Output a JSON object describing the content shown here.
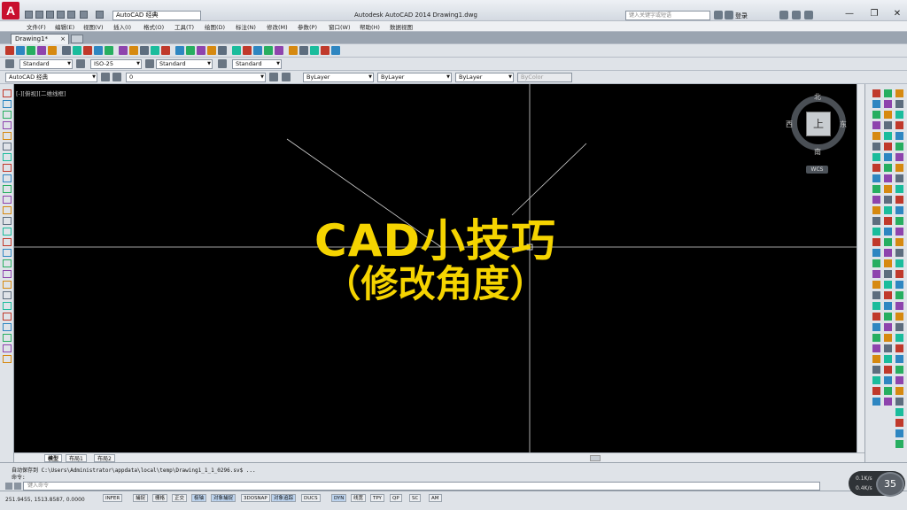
{
  "titlebar": {
    "app_logo": "A",
    "workspace": "AutoCAD 经典",
    "title": "Autodesk AutoCAD 2014    Drawing1.dwg",
    "search_placeholder": "键入关键字或短语",
    "login": "登录",
    "minimize": "—",
    "restore": "❐",
    "close": "✕"
  },
  "menu": [
    "文件(F)",
    "编辑(E)",
    "视图(V)",
    "插入(I)",
    "格式(O)",
    "工具(T)",
    "绘图(D)",
    "标注(N)",
    "修改(M)",
    "参数(P)",
    "窗口(W)",
    "帮助(H)",
    "数据视图"
  ],
  "tabs": {
    "doc_tab": "Drawing1*",
    "close": "×"
  },
  "styles": {
    "text_style": "Standard",
    "dim_style": "ISO-25",
    "table_style": "Standard",
    "mleader_style": "Standard"
  },
  "layers": {
    "workspace": "AutoCAD 经典",
    "layer": "0",
    "color": "ByLayer",
    "linetype": "ByLayer",
    "lineweight": "ByLayer",
    "plotstyle": "ByColor"
  },
  "viewport": {
    "label": "[-][俯视][二维线框]",
    "overlay_line1": "CAD小技巧",
    "overlay_line2": "（修改角度）",
    "compass": {
      "north": "北",
      "south": "南",
      "east": "东",
      "west": "西",
      "top": "上",
      "ucs": "WCS"
    }
  },
  "layout_tabs": [
    "模型",
    "布局1",
    "布局2"
  ],
  "command": {
    "history1": "自动保存到 C:\\Users\\Administrator\\appdata\\local\\temp\\Drawing1_1_1_0296.sv$ ...",
    "history2": "命令:",
    "input_placeholder": "键入命令"
  },
  "status": {
    "coords": "251.9455, 1513.8587, 0.0000",
    "buttons": [
      "INFER",
      "捕捉",
      "栅格",
      "正交",
      "极轴",
      "对象捕捉",
      "3DOSNAP",
      "对象追踪",
      "DUCS",
      "DYN",
      "线宽",
      "TPY",
      "QP",
      "SC",
      "AM"
    ],
    "active": [
      "极轴",
      "对象捕捉",
      "对象追踪",
      "DYN"
    ]
  },
  "speed": {
    "upload": "0.1K/s",
    "download": "0.4K/s",
    "percent": "35"
  },
  "colors": {
    "overlay": "#f5d400",
    "background": "#000000",
    "crosshair": "#d8d8d8"
  }
}
